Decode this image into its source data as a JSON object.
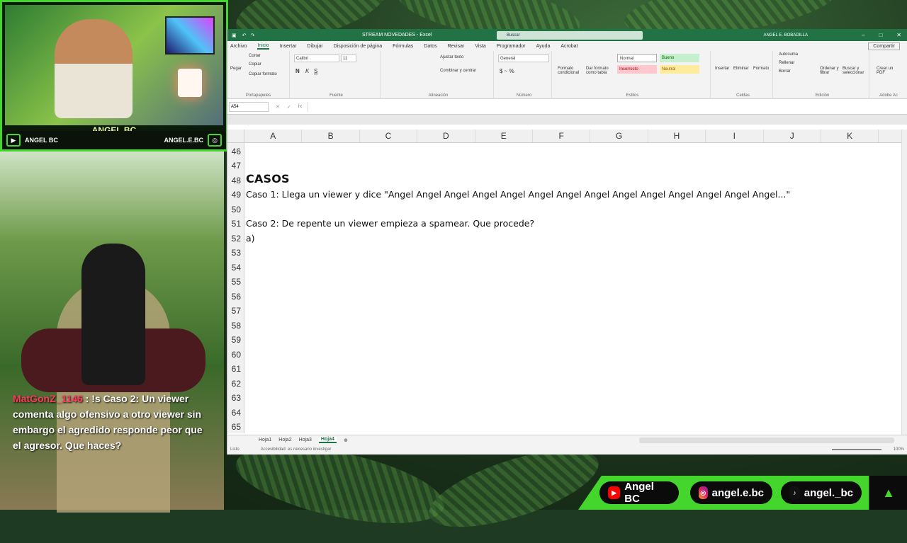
{
  "overlay": {
    "cam_name": "ANGEL BC",
    "cam_left_label": "ANGEL BC",
    "cam_right_label": "ANGEL.E.BC",
    "chat_user": "MatGonZ_1146",
    "chat_message": "!s Caso 2: Un viewer comenta algo ofensivo a otro viewer sin embargo el agredido responde peor que el agresor. Que haces?",
    "socials": {
      "youtube": "Angel BC",
      "instagram": "angel.e.bc",
      "tiktok": "angel._bc"
    }
  },
  "excel": {
    "file_title": "STREAM NOVEDADES  -  Excel",
    "search_placeholder": "Buscar",
    "user_name": "ANGEL E. BOBADILLA",
    "menu": [
      "Archivo",
      "Inicio",
      "Insertar",
      "Dibujar",
      "Disposición de página",
      "Fórmulas",
      "Datos",
      "Revisar",
      "Vista",
      "Programador",
      "Ayuda",
      "Acrobat"
    ],
    "active_menu": "Inicio",
    "share_label": "Compartir",
    "ribbon": {
      "paste": "Pegar",
      "cut": "Cortar",
      "copy": "Copiar",
      "format_painter": "Copiar formato",
      "clipboard_label": "Portapapeles",
      "font_name": "Calibri",
      "font_size": "11",
      "font_label": "Fuente",
      "wrap_text": "Ajustar texto",
      "merge": "Combinar y centrar",
      "alignment_label": "Alineación",
      "number_format": "General",
      "number_label": "Número",
      "conditional_format": "Formato condicional",
      "format_as_table": "Dar formato como tabla",
      "styles_label": "Estilos",
      "style_normal": "Normal",
      "style_good": "Bueno",
      "style_bad": "Incorrecto",
      "style_neutral": "Neutral",
      "insert": "Insertar",
      "delete": "Eliminar",
      "format": "Formato",
      "cells_label": "Celdas",
      "autosum": "Autosuma",
      "fill": "Rellenar",
      "clear": "Borrar",
      "sort_filter": "Ordenar y filtrar",
      "find_select": "Buscar y seleccionar",
      "editing_label": "Edición",
      "create_pdf": "Crear un PDF",
      "adobe_label": "Adobe Ac"
    },
    "name_box": "A54",
    "columns": [
      "A",
      "B",
      "C",
      "D",
      "E",
      "F",
      "G",
      "H",
      "I",
      "J",
      "K"
    ],
    "rows": [
      {
        "n": "46",
        "text": "",
        "head": false
      },
      {
        "n": "47",
        "text": "",
        "head": false
      },
      {
        "n": "48",
        "text": "CASOS",
        "head": true
      },
      {
        "n": "49",
        "text": "Caso 1: Llega un viewer y dice \"Angel Angel Angel Angel Angel Angel Angel Angel Angel Angel Angel Angel Angel Angel...\"",
        "head": false
      },
      {
        "n": "50",
        "text": "",
        "head": false
      },
      {
        "n": "51",
        "text": "Caso 2: De repente un viewer empieza a spamear. Que procede?",
        "head": false
      },
      {
        "n": "52",
        "text": "a)",
        "head": false
      },
      {
        "n": "53",
        "text": "",
        "head": false
      },
      {
        "n": "54",
        "text": "",
        "head": false
      },
      {
        "n": "55",
        "text": "",
        "head": false
      },
      {
        "n": "56",
        "text": "",
        "head": false
      },
      {
        "n": "57",
        "text": "",
        "head": false
      },
      {
        "n": "58",
        "text": "",
        "head": false
      },
      {
        "n": "59",
        "text": "",
        "head": false
      },
      {
        "n": "60",
        "text": "",
        "head": false
      },
      {
        "n": "61",
        "text": "",
        "head": false
      },
      {
        "n": "62",
        "text": "",
        "head": false
      },
      {
        "n": "63",
        "text": "",
        "head": false
      },
      {
        "n": "64",
        "text": "",
        "head": false
      },
      {
        "n": "65",
        "text": "",
        "head": false
      }
    ],
    "sheets": [
      "Hoja1",
      "Hoja2",
      "Hoja3",
      "Hoja4"
    ],
    "active_sheet": "Hoja4",
    "status_ready": "Listo",
    "status_accessibility": "Accesibilidad: es necesario investigar",
    "zoom": "100%"
  }
}
